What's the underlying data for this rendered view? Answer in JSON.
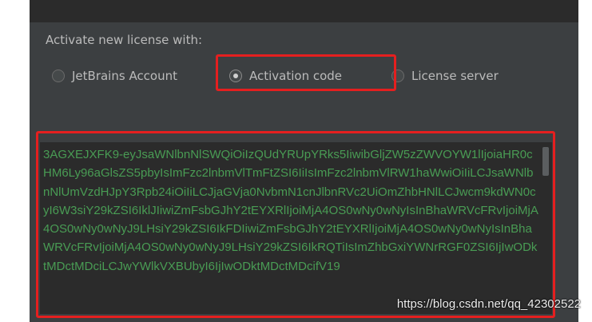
{
  "dialog": {
    "activate_label": "Activate new license with:",
    "options": [
      {
        "label": "JetBrains Account",
        "selected": false
      },
      {
        "label": "Activation code",
        "selected": true
      },
      {
        "label": "License server",
        "selected": false
      }
    ],
    "activation_code": "3AGXEJXFK9-eyJsaWNlbnNlSWQiOiIzQUdYRUpYRks5IiwibGljZW5zZWVOYW1lIjoiaHR0cHM6Ly96aGlsZS5pbyIsImFzc2lnbmVlTmFtZSI6IiIsImFzc2lnbmVlRW1haWwiOiIiLCJsaWNlbnNlUmVzdHJpY3Rpb24iOiIiLCJjaGVja0NvbmN1cnJlbnRVc2UiOmZhbHNlLCJwcm9kdWN0cyI6W3siY29kZSI6IklJIiwiZmFsbGJhY2tEYXRlIjoiMjA4OS0wNy0wNyIsInBhaWRVcFRvIjoiMjA4OS0wNy0wNyJ9LHsiY29kZSI6IkFDIiwiZmFsbGJhY2tEYXRlIjoiMjA4OS0wNy0wNyIsInBhaWRVcFRvIjoiMjA4OS0wNy0wNyJ9LHsiY29kZSI6IkRQTiIsImZhbGxiYWNrRGF0ZSI6IjIwODktMDctMDciLCJwYWlkVXBUbyI6IjIwODktMDctMDcifV19"
  },
  "watermark": "https://blog.csdn.net/qq_42302522",
  "colors": {
    "dialog_bg": "#3c3f41",
    "code_bg": "#2b2b2b",
    "code_text": "#499c54",
    "highlight": "#e51f1f"
  }
}
